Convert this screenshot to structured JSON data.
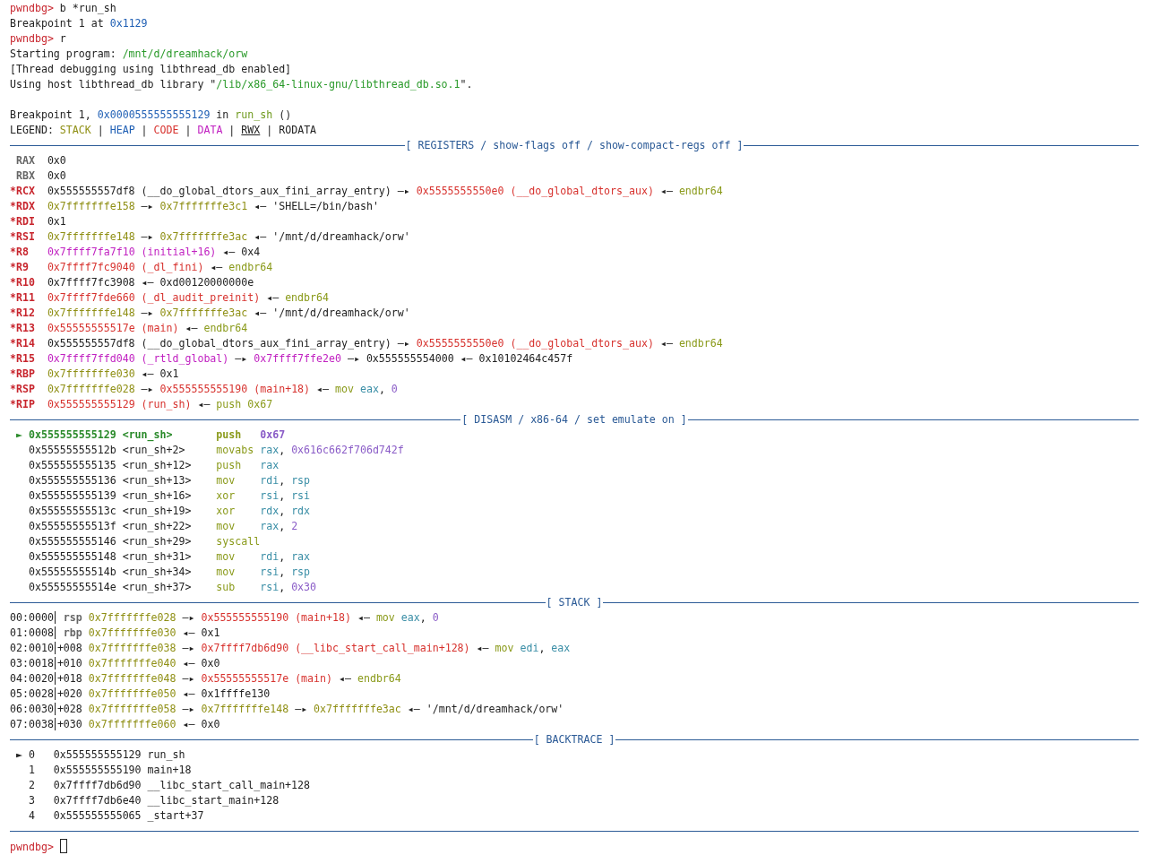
{
  "terminal": {
    "lines": [
      {
        "kind": "text",
        "segments": [
          {
            "text": "pwndbg> ",
            "kind": "prompt"
          },
          {
            "text": "b *run_sh",
            "kind": "plain"
          }
        ]
      },
      {
        "kind": "text",
        "segments": [
          {
            "text": "Breakpoint 1 at ",
            "kind": "plain"
          },
          {
            "text": "0x1129",
            "kind": "num"
          }
        ]
      },
      {
        "kind": "text",
        "segments": [
          {
            "text": "pwndbg> ",
            "kind": "prompt"
          },
          {
            "text": "r",
            "kind": "plain"
          }
        ]
      },
      {
        "kind": "text",
        "segments": [
          {
            "text": "Starting program: ",
            "kind": "plain"
          },
          {
            "text": "/mnt/d/dreamhack/orw",
            "kind": "path"
          }
        ]
      },
      {
        "kind": "text",
        "segments": [
          {
            "text": "[Thread debugging using libthread_db enabled]",
            "kind": "plain"
          }
        ]
      },
      {
        "kind": "text",
        "segments": [
          {
            "text": "Using host libthread_db library \"",
            "kind": "plain"
          },
          {
            "text": "/lib/x86_64-linux-gnu/libthread_db.so.1",
            "kind": "path"
          },
          {
            "text": "\".",
            "kind": "plain"
          }
        ]
      },
      {
        "kind": "blank"
      },
      {
        "kind": "text",
        "segments": [
          {
            "text": "Breakpoint 1, ",
            "kind": "plain"
          },
          {
            "text": "0x0000555555555129",
            "kind": "num"
          },
          {
            "text": " in ",
            "kind": "plain"
          },
          {
            "text": "run_sh",
            "kind": "func"
          },
          {
            "text": " ()",
            "kind": "plain"
          }
        ]
      },
      {
        "kind": "text",
        "segments": [
          {
            "text": "LEGEND: ",
            "kind": "plain"
          },
          {
            "text": "STACK",
            "kind": "stack"
          },
          {
            "text": " | ",
            "kind": "plain"
          },
          {
            "text": "HEAP",
            "kind": "num"
          },
          {
            "text": " | ",
            "kind": "plain"
          },
          {
            "text": "CODE",
            "kind": "code"
          },
          {
            "text": " | ",
            "kind": "plain"
          },
          {
            "text": "DATA",
            "kind": "data"
          },
          {
            "text": " | ",
            "kind": "plain"
          },
          {
            "text": "RWX",
            "kind": "rwx"
          },
          {
            "text": " | RODATA",
            "kind": "plain"
          }
        ]
      },
      {
        "kind": "rule",
        "label": "[ REGISTERS / show-flags off / show-compact-regs off ]"
      },
      {
        "kind": "text",
        "segments": [
          {
            "text": " RAX",
            "kind": "regname"
          },
          {
            "text": "  0x0",
            "kind": "plain"
          }
        ]
      },
      {
        "kind": "text",
        "segments": [
          {
            "text": " RBX",
            "kind": "regname"
          },
          {
            "text": "  0x0",
            "kind": "plain"
          }
        ]
      },
      {
        "kind": "text",
        "segments": [
          {
            "text": "*RCX",
            "kind": "regchanged"
          },
          {
            "text": "  0x555555557df8 (__do_global_dtors_aux_fini_array_entry) —▸ ",
            "kind": "plain"
          },
          {
            "text": "0x5555555550e0 (__do_global_dtors_aux)",
            "kind": "code"
          },
          {
            "text": " ◂— ",
            "kind": "plain"
          },
          {
            "text": "endbr64",
            "kind": "insn"
          }
        ]
      },
      {
        "kind": "text",
        "segments": [
          {
            "text": "*RDX  ",
            "kind": "regchanged"
          },
          {
            "text": "0x7fffffffe158",
            "kind": "stack"
          },
          {
            "text": " —▸ ",
            "kind": "plain"
          },
          {
            "text": "0x7fffffffe3c1",
            "kind": "stack"
          },
          {
            "text": " ◂— 'SHELL=/bin/bash'",
            "kind": "plain"
          }
        ]
      },
      {
        "kind": "text",
        "segments": [
          {
            "text": "*RDI",
            "kind": "regchanged"
          },
          {
            "text": "  0x1",
            "kind": "plain"
          }
        ]
      },
      {
        "kind": "text",
        "segments": [
          {
            "text": "*RSI  ",
            "kind": "regchanged"
          },
          {
            "text": "0x7fffffffe148",
            "kind": "stack"
          },
          {
            "text": " —▸ ",
            "kind": "plain"
          },
          {
            "text": "0x7fffffffe3ac",
            "kind": "stack"
          },
          {
            "text": " ◂— '/mnt/d/dreamhack/orw'",
            "kind": "plain"
          }
        ]
      },
      {
        "kind": "text",
        "segments": [
          {
            "text": "*R8   ",
            "kind": "regchanged"
          },
          {
            "text": "0x7ffff7fa7f10 (initial+16)",
            "kind": "data"
          },
          {
            "text": " ◂— 0x4",
            "kind": "plain"
          }
        ]
      },
      {
        "kind": "text",
        "segments": [
          {
            "text": "*R9   ",
            "kind": "regchanged"
          },
          {
            "text": "0x7ffff7fc9040 (_dl_fini)",
            "kind": "code"
          },
          {
            "text": " ◂— ",
            "kind": "plain"
          },
          {
            "text": "endbr64",
            "kind": "insn"
          }
        ]
      },
      {
        "kind": "text",
        "segments": [
          {
            "text": "*R10",
            "kind": "regchanged"
          },
          {
            "text": "  0x7ffff7fc3908 ◂— 0xd00120000000e",
            "kind": "plain"
          }
        ]
      },
      {
        "kind": "text",
        "segments": [
          {
            "text": "*R11  ",
            "kind": "regchanged"
          },
          {
            "text": "0x7ffff7fde660 (_dl_audit_preinit)",
            "kind": "code"
          },
          {
            "text": " ◂— ",
            "kind": "plain"
          },
          {
            "text": "endbr64",
            "kind": "insn"
          }
        ]
      },
      {
        "kind": "text",
        "segments": [
          {
            "text": "*R12  ",
            "kind": "regchanged"
          },
          {
            "text": "0x7fffffffe148",
            "kind": "stack"
          },
          {
            "text": " —▸ ",
            "kind": "plain"
          },
          {
            "text": "0x7fffffffe3ac",
            "kind": "stack"
          },
          {
            "text": " ◂— '/mnt/d/dreamhack/orw'",
            "kind": "plain"
          }
        ]
      },
      {
        "kind": "text",
        "segments": [
          {
            "text": "*R13  ",
            "kind": "regchanged"
          },
          {
            "text": "0x55555555517e (main)",
            "kind": "code"
          },
          {
            "text": " ◂— ",
            "kind": "plain"
          },
          {
            "text": "endbr64",
            "kind": "insn"
          }
        ]
      },
      {
        "kind": "text",
        "segments": [
          {
            "text": "*R14",
            "kind": "regchanged"
          },
          {
            "text": "  0x555555557df8 (__do_global_dtors_aux_fini_array_entry) —▸ ",
            "kind": "plain"
          },
          {
            "text": "0x5555555550e0 (__do_global_dtors_aux)",
            "kind": "code"
          },
          {
            "text": " ◂— ",
            "kind": "plain"
          },
          {
            "text": "endbr64",
            "kind": "insn"
          }
        ]
      },
      {
        "kind": "text",
        "segments": [
          {
            "text": "*R15  ",
            "kind": "regchanged"
          },
          {
            "text": "0x7ffff7ffd040 (_rtld_global)",
            "kind": "data"
          },
          {
            "text": " —▸ ",
            "kind": "plain"
          },
          {
            "text": "0x7ffff7ffe2e0",
            "kind": "data"
          },
          {
            "text": " —▸ 0x555555554000 ◂— 0x10102464c457f",
            "kind": "plain"
          }
        ]
      },
      {
        "kind": "text",
        "segments": [
          {
            "text": "*RBP  ",
            "kind": "regchanged"
          },
          {
            "text": "0x7fffffffe030",
            "kind": "stack"
          },
          {
            "text": " ◂— 0x1",
            "kind": "plain"
          }
        ]
      },
      {
        "kind": "text",
        "segments": [
          {
            "text": "*RSP  ",
            "kind": "regchanged"
          },
          {
            "text": "0x7fffffffe028",
            "kind": "stack"
          },
          {
            "text": " —▸ ",
            "kind": "plain"
          },
          {
            "text": "0x555555555190 (main+18)",
            "kind": "code"
          },
          {
            "text": " ◂— ",
            "kind": "plain"
          },
          {
            "text": "mov ",
            "kind": "insn"
          },
          {
            "text": "eax",
            "kind": "reg"
          },
          {
            "text": ", ",
            "kind": "plain"
          },
          {
            "text": "0",
            "kind": "imm"
          }
        ]
      },
      {
        "kind": "text",
        "segments": [
          {
            "text": "*RIP  ",
            "kind": "regchanged"
          },
          {
            "text": "0x555555555129 (run_sh)",
            "kind": "code"
          },
          {
            "text": " ◂— ",
            "kind": "plain"
          },
          {
            "text": "push 0x67",
            "kind": "insn"
          }
        ]
      },
      {
        "kind": "rule",
        "label": "[ DISASM / x86-64 / set emulate on ]"
      },
      {
        "kind": "text",
        "segments": [
          {
            "text": " ► ",
            "kind": "marker"
          },
          {
            "text": "0x555555555129 <run_sh>       ",
            "kind": "current"
          },
          {
            "text": "push   ",
            "kind": "curinsn"
          },
          {
            "text": "0x67",
            "kind": "curimm"
          }
        ]
      },
      {
        "kind": "text",
        "segments": [
          {
            "text": "   0x55555555512b <run_sh+2>     ",
            "kind": "plain"
          },
          {
            "text": "movabs ",
            "kind": "insn"
          },
          {
            "text": "rax",
            "kind": "reg"
          },
          {
            "text": ", ",
            "kind": "plain"
          },
          {
            "text": "0x616c662f706d742f",
            "kind": "imm"
          }
        ]
      },
      {
        "kind": "text",
        "segments": [
          {
            "text": "   0x555555555135 <run_sh+12>    ",
            "kind": "plain"
          },
          {
            "text": "push   ",
            "kind": "insn"
          },
          {
            "text": "rax",
            "kind": "reg"
          }
        ]
      },
      {
        "kind": "text",
        "segments": [
          {
            "text": "   0x555555555136 <run_sh+13>    ",
            "kind": "plain"
          },
          {
            "text": "mov    ",
            "kind": "insn"
          },
          {
            "text": "rdi",
            "kind": "reg"
          },
          {
            "text": ", ",
            "kind": "plain"
          },
          {
            "text": "rsp",
            "kind": "reg"
          }
        ]
      },
      {
        "kind": "text",
        "segments": [
          {
            "text": "   0x555555555139 <run_sh+16>    ",
            "kind": "plain"
          },
          {
            "text": "xor    ",
            "kind": "insn"
          },
          {
            "text": "rsi",
            "kind": "reg"
          },
          {
            "text": ", ",
            "kind": "plain"
          },
          {
            "text": "rsi",
            "kind": "reg"
          }
        ]
      },
      {
        "kind": "text",
        "segments": [
          {
            "text": "   0x55555555513c <run_sh+19>    ",
            "kind": "plain"
          },
          {
            "text": "xor    ",
            "kind": "insn"
          },
          {
            "text": "rdx",
            "kind": "reg"
          },
          {
            "text": ", ",
            "kind": "plain"
          },
          {
            "text": "rdx",
            "kind": "reg"
          }
        ]
      },
      {
        "kind": "text",
        "segments": [
          {
            "text": "   0x55555555513f <run_sh+22>    ",
            "kind": "plain"
          },
          {
            "text": "mov    ",
            "kind": "insn"
          },
          {
            "text": "rax",
            "kind": "reg"
          },
          {
            "text": ", ",
            "kind": "plain"
          },
          {
            "text": "2",
            "kind": "imm"
          }
        ]
      },
      {
        "kind": "text",
        "segments": [
          {
            "text": "   0x555555555146 <run_sh+29>    ",
            "kind": "plain"
          },
          {
            "text": "syscall",
            "kind": "insn"
          }
        ]
      },
      {
        "kind": "text",
        "segments": [
          {
            "text": "   0x555555555148 <run_sh+31>    ",
            "kind": "plain"
          },
          {
            "text": "mov    ",
            "kind": "insn"
          },
          {
            "text": "rdi",
            "kind": "reg"
          },
          {
            "text": ", ",
            "kind": "plain"
          },
          {
            "text": "rax",
            "kind": "reg"
          }
        ]
      },
      {
        "kind": "text",
        "segments": [
          {
            "text": "   0x55555555514b <run_sh+34>    ",
            "kind": "plain"
          },
          {
            "text": "mov    ",
            "kind": "insn"
          },
          {
            "text": "rsi",
            "kind": "reg"
          },
          {
            "text": ", ",
            "kind": "plain"
          },
          {
            "text": "rsp",
            "kind": "reg"
          }
        ]
      },
      {
        "kind": "text",
        "segments": [
          {
            "text": "   0x55555555514e <run_sh+37>    ",
            "kind": "plain"
          },
          {
            "text": "sub    ",
            "kind": "insn"
          },
          {
            "text": "rsi",
            "kind": "reg"
          },
          {
            "text": ", ",
            "kind": "plain"
          },
          {
            "text": "0x30",
            "kind": "imm"
          }
        ]
      },
      {
        "kind": "rule",
        "label": "[ STACK ]"
      },
      {
        "kind": "text",
        "segments": [
          {
            "text": "00:0000",
            "kind": "offset"
          },
          {
            "text": " rsp ",
            "kind": "regname"
          },
          {
            "text": "0x7fffffffe028",
            "kind": "stack"
          },
          {
            "text": " —▸ ",
            "kind": "plain"
          },
          {
            "text": "0x555555555190 (main+18)",
            "kind": "code"
          },
          {
            "text": " ◂— ",
            "kind": "plain"
          },
          {
            "text": "mov ",
            "kind": "insn"
          },
          {
            "text": "eax",
            "kind": "reg"
          },
          {
            "text": ", ",
            "kind": "plain"
          },
          {
            "text": "0",
            "kind": "imm"
          }
        ]
      },
      {
        "kind": "text",
        "segments": [
          {
            "text": "01:0008",
            "kind": "offset"
          },
          {
            "text": " rbp ",
            "kind": "regname"
          },
          {
            "text": "0x7fffffffe030",
            "kind": "stack"
          },
          {
            "text": " ◂— 0x1",
            "kind": "plain"
          }
        ]
      },
      {
        "kind": "text",
        "segments": [
          {
            "text": "02:0010",
            "kind": "offset"
          },
          {
            "text": "+008 ",
            "kind": "plain"
          },
          {
            "text": "0x7fffffffe038",
            "kind": "stack"
          },
          {
            "text": " —▸ ",
            "kind": "plain"
          },
          {
            "text": "0x7ffff7db6d90 (__libc_start_call_main+128)",
            "kind": "code"
          },
          {
            "text": " ◂— ",
            "kind": "plain"
          },
          {
            "text": "mov ",
            "kind": "insn"
          },
          {
            "text": "edi",
            "kind": "reg"
          },
          {
            "text": ", ",
            "kind": "plain"
          },
          {
            "text": "eax",
            "kind": "reg"
          }
        ]
      },
      {
        "kind": "text",
        "segments": [
          {
            "text": "03:0018",
            "kind": "offset"
          },
          {
            "text": "+010 ",
            "kind": "plain"
          },
          {
            "text": "0x7fffffffe040",
            "kind": "stack"
          },
          {
            "text": " ◂— 0x0",
            "kind": "plain"
          }
        ]
      },
      {
        "kind": "text",
        "segments": [
          {
            "text": "04:0020",
            "kind": "offset"
          },
          {
            "text": "+018 ",
            "kind": "plain"
          },
          {
            "text": "0x7fffffffe048",
            "kind": "stack"
          },
          {
            "text": " —▸ ",
            "kind": "plain"
          },
          {
            "text": "0x55555555517e (main)",
            "kind": "code"
          },
          {
            "text": " ◂— ",
            "kind": "plain"
          },
          {
            "text": "endbr64",
            "kind": "insn"
          }
        ]
      },
      {
        "kind": "text",
        "segments": [
          {
            "text": "05:0028",
            "kind": "offset"
          },
          {
            "text": "+020 ",
            "kind": "plain"
          },
          {
            "text": "0x7fffffffe050",
            "kind": "stack"
          },
          {
            "text": " ◂— 0x1ffffe130",
            "kind": "plain"
          }
        ]
      },
      {
        "kind": "text",
        "segments": [
          {
            "text": "06:0030",
            "kind": "offset"
          },
          {
            "text": "+028 ",
            "kind": "plain"
          },
          {
            "text": "0x7fffffffe058",
            "kind": "stack"
          },
          {
            "text": " —▸ ",
            "kind": "plain"
          },
          {
            "text": "0x7fffffffe148",
            "kind": "stack"
          },
          {
            "text": " —▸ ",
            "kind": "plain"
          },
          {
            "text": "0x7fffffffe3ac",
            "kind": "stack"
          },
          {
            "text": " ◂— '/mnt/d/dreamhack/orw'",
            "kind": "plain"
          }
        ]
      },
      {
        "kind": "text",
        "segments": [
          {
            "text": "07:0038",
            "kind": "offset"
          },
          {
            "text": "+030 ",
            "kind": "plain"
          },
          {
            "text": "0x7fffffffe060",
            "kind": "stack"
          },
          {
            "text": " ◂— 0x0",
            "kind": "plain"
          }
        ]
      },
      {
        "kind": "rule",
        "label": "[ BACKTRACE ]"
      },
      {
        "kind": "text",
        "segments": [
          {
            "text": " ► 0   0x555555555129 run_sh",
            "kind": "plain"
          }
        ]
      },
      {
        "kind": "text",
        "segments": [
          {
            "text": "   1   0x555555555190 main+18",
            "kind": "plain"
          }
        ]
      },
      {
        "kind": "text",
        "segments": [
          {
            "text": "   2   0x7ffff7db6d90 __libc_start_call_main+128",
            "kind": "plain"
          }
        ]
      },
      {
        "kind": "text",
        "segments": [
          {
            "text": "   3   0x7ffff7db6e40 __libc_start_main+128",
            "kind": "plain"
          }
        ]
      },
      {
        "kind": "text",
        "segments": [
          {
            "text": "   4   0x555555555065 _start+37",
            "kind": "plain"
          }
        ]
      },
      {
        "kind": "rule"
      },
      {
        "kind": "text",
        "segments": [
          {
            "text": "pwndbg> ",
            "kind": "prompt"
          },
          {
            "kind": "cursor"
          }
        ]
      }
    ]
  }
}
